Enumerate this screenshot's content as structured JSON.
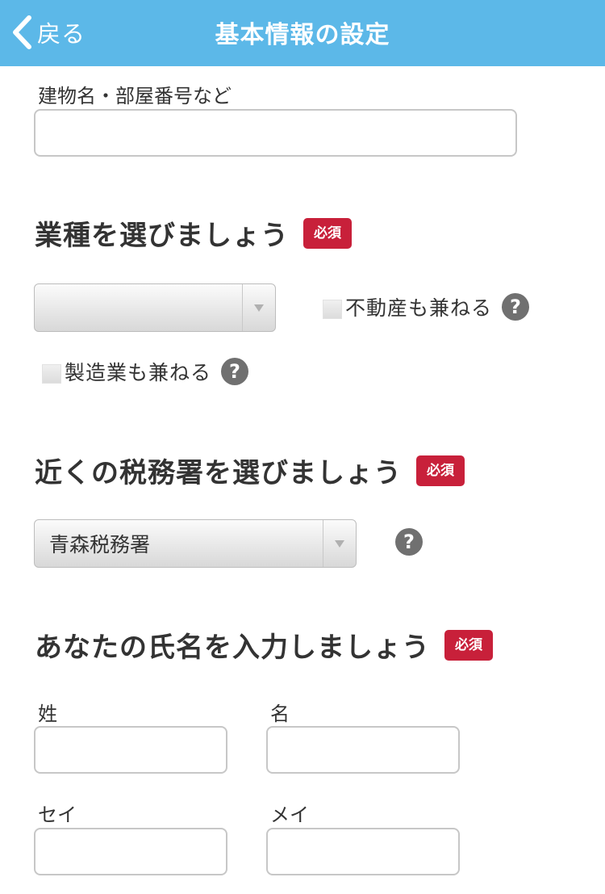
{
  "header": {
    "back_label": "戻る",
    "title": "基本情報の設定"
  },
  "building": {
    "label": "建物名・部屋番号など",
    "value": "",
    "placeholder": ""
  },
  "industry": {
    "title": "業種を選びましょう",
    "badge": "必須",
    "selected": "",
    "real_estate_label": "不動産も兼ねる",
    "manufacturing_label": "製造業も兼ねる"
  },
  "tax_office": {
    "title": "近くの税務署を選びましょう",
    "badge": "必須",
    "selected": "青森税務署"
  },
  "name": {
    "title": "あなたの氏名を入力しましょう",
    "badge": "必須",
    "last_label": "姓",
    "first_label": "名",
    "last_kana_label": "セイ",
    "first_kana_label": "メイ",
    "last_value": "",
    "first_value": "",
    "last_kana_value": "",
    "first_kana_value": ""
  },
  "icons": {
    "help": "?",
    "back": "chevron-left-icon",
    "dropdown": "triangle-down-icon"
  },
  "colors": {
    "header_bg": "#5cb8e8",
    "badge_bg": "#c8203a",
    "help_bg": "#707070"
  }
}
